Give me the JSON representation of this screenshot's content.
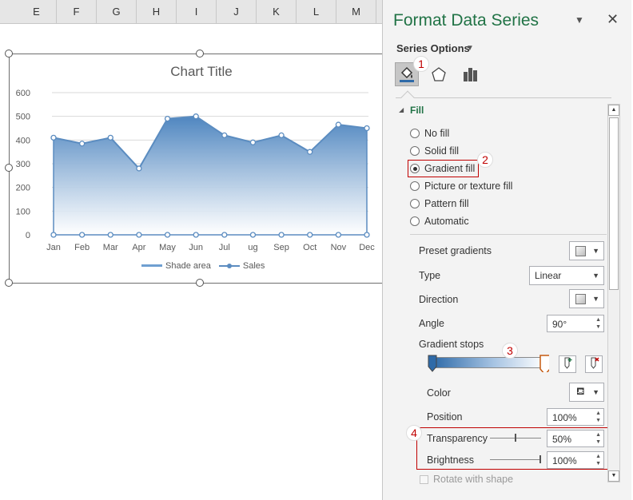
{
  "sheet": {
    "columns": [
      "E",
      "F",
      "G",
      "H",
      "I",
      "J",
      "K",
      "L",
      "M"
    ]
  },
  "chart": {
    "title": "Chart Title",
    "legend": [
      "Shade area",
      "Sales"
    ],
    "colors": {
      "line": "#5b8cc0",
      "fill_top": "#4f86c0",
      "fill_bottom": "#ffffff",
      "grid": "#d9d9d9"
    }
  },
  "chart_data": {
    "type": "area",
    "title": "Chart Title",
    "categories": [
      "Jan",
      "Feb",
      "Mar",
      "Apr",
      "May",
      "Jun",
      "Jul",
      "ug",
      "Sep",
      "Oct",
      "Nov",
      "Dec"
    ],
    "series": [
      {
        "name": "Shade area",
        "values": [
          410,
          385,
          410,
          280,
          490,
          500,
          420,
          390,
          420,
          350,
          465,
          450
        ]
      },
      {
        "name": "Sales",
        "values": [
          0,
          0,
          0,
          0,
          0,
          0,
          0,
          0,
          0,
          0,
          0,
          0
        ]
      }
    ],
    "yticks": [
      "0",
      "100",
      "200",
      "300",
      "400",
      "500",
      "600"
    ],
    "ylim": [
      0,
      600
    ],
    "grid": true,
    "legend_position": "bottom"
  },
  "panel": {
    "title": "Format Data Series",
    "series_options": "Series Options",
    "section": "Fill",
    "fill_options": [
      {
        "label": "No fill",
        "selected": false
      },
      {
        "label": "Solid fill",
        "selected": false
      },
      {
        "label": "Gradient fill",
        "selected": true
      },
      {
        "label": "Picture or texture fill",
        "selected": false
      },
      {
        "label": "Pattern fill",
        "selected": false
      },
      {
        "label": "Automatic",
        "selected": false
      }
    ],
    "preset_gradients": "Preset gradients",
    "type_label": "Type",
    "type_value": "Linear",
    "direction_label": "Direction",
    "angle_label": "Angle",
    "angle_value": "90°",
    "gradient_stops": "Gradient stops",
    "color_label": "Color",
    "position_label": "Position",
    "position_value": "100%",
    "transparency_label": "Transparency",
    "transparency_value": "50%",
    "brightness_label": "Brightness",
    "brightness_value": "100%",
    "rotate_label": "Rotate with shape"
  },
  "annotations": [
    "1",
    "2",
    "3",
    "4"
  ]
}
